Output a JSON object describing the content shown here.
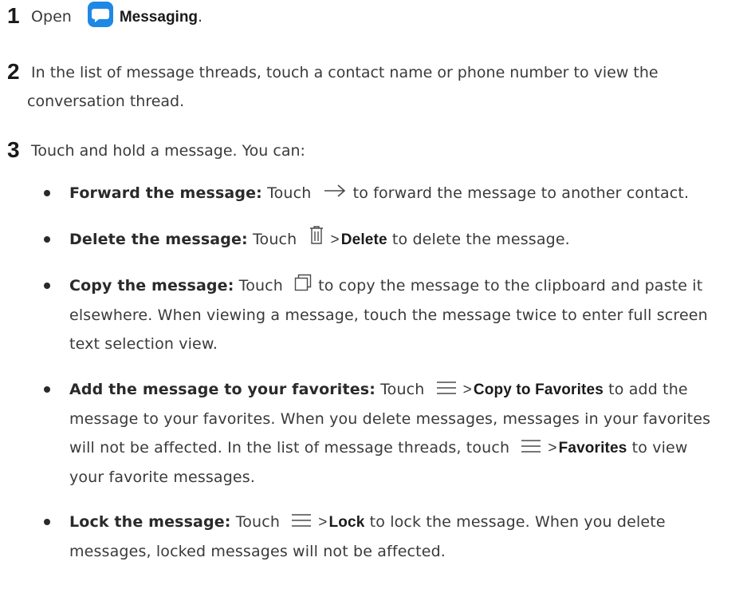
{
  "steps": [
    {
      "num": "1",
      "text_before": "Open",
      "app_name": "Messaging",
      "text_after": "."
    },
    {
      "num": "2",
      "line1": "In the list of message threads, touch a contact name or phone number to view the",
      "line2": "conversation thread."
    },
    {
      "num": "3",
      "text": "Touch and hold a message. You can:"
    }
  ],
  "bullets": {
    "forward": {
      "lead": "Forward the message:",
      "pre": "Touch",
      "post": "to forward the message to another contact."
    },
    "delete": {
      "lead": "Delete the message:",
      "pre": "Touch",
      "sep": ">",
      "ui": "Delete",
      "post": "to delete the message."
    },
    "copy": {
      "lead": "Copy the message:",
      "pre": "Touch",
      "post": "to copy the message to the clipboard and paste it",
      "line2": "elsewhere. When viewing a message, touch the message twice to enter full screen",
      "line3": "text selection view."
    },
    "favorites": {
      "lead": "Add the message to your favorites:",
      "pre": "Touch",
      "sep": ">",
      "ui": "Copy to Favorites",
      "post": "to add the",
      "line2": "message to your favorites. When you delete messages, messages in your favorites",
      "line3_pre": "will not be affected. In the list of message threads, touch",
      "line3_sep": ">",
      "line3_ui": "Favorites",
      "line3_post": "to view",
      "line4": "your favorite messages."
    },
    "lock": {
      "lead": "Lock the message:",
      "pre": "Touch",
      "sep": ">",
      "ui": "Lock",
      "post": "to lock the message. When you delete",
      "line2": "messages, locked messages will not be affected."
    }
  },
  "icons": {
    "messaging_app": "message-bubble-icon",
    "forward": "arrow-right-icon",
    "delete": "trash-icon",
    "copy": "copy-icon",
    "menu": "menu-icon"
  },
  "colors": {
    "app_icon_bg": "#1e88e5",
    "text": "#3a3a3a",
    "heading": "#1a1a1a"
  }
}
